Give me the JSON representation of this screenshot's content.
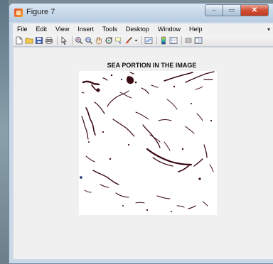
{
  "window": {
    "title": "Figure 7",
    "caption": {
      "minimize": "–",
      "maximize": "▭",
      "close": "✕"
    }
  },
  "menu": {
    "items": [
      "File",
      "Edit",
      "View",
      "Insert",
      "Tools",
      "Desktop",
      "Window",
      "Help"
    ],
    "overflow": "▾"
  },
  "toolbar": {
    "icons": [
      "new-figure-icon",
      "open-file-icon",
      "save-icon",
      "print-icon",
      "edit-pointer-icon",
      "zoom-in-icon",
      "zoom-out-icon",
      "pan-icon",
      "rotate-3d-icon",
      "data-cursor-icon",
      "brush-icon",
      "link-plot-icon",
      "colorbar-icon",
      "legend-icon",
      "hide-plot-tools-icon",
      "show-plot-tools-icon"
    ]
  },
  "figure": {
    "title": "SEA PORTION IN THE IMAGE",
    "colors": {
      "foreground": "#3a0a14",
      "background": "#ffffff",
      "accent": "#1b2a6b"
    }
  }
}
